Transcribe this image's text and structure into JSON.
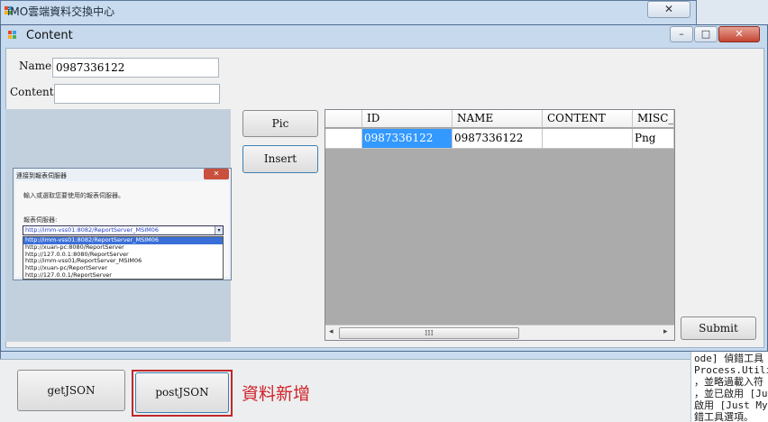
{
  "back_window": {
    "title": "iMO雲端資料交換中心",
    "close_glyph": "✕"
  },
  "content_window": {
    "title": "Content",
    "minimize_glyph": "–",
    "maximize_glyph": "□",
    "close_glyph": "✕",
    "name_label": "Name",
    "name_value": "0987336122",
    "content_label": "Content",
    "content_value": "",
    "pic_button": "Pic",
    "insert_button": "Insert",
    "submit_button": "Submit"
  },
  "embedded_dialog": {
    "title": "連接到報表伺服器",
    "close_glyph": "✕",
    "description": "輸入或選取您要使用的報表伺服器。",
    "combo_label": "報表伺服器:",
    "combo_value": "http://imm-vss01:8082/ReportServer_MSIM06",
    "combo_arrow": "▾",
    "options": [
      "http://imm-vss01:8082/ReportServer_MSIM06",
      "http://xuan-pc:8080/ReportServer",
      "http://127.0.0.1:8080/ReportServer",
      "http://imm-vss01/ReportServer_MSIM06",
      "http://xuan-pc/ReportServer",
      "http://127.0.0.1/ReportServer"
    ]
  },
  "grid": {
    "columns": [
      "ID",
      "NAME",
      "CONTENT",
      "MISC_T"
    ],
    "rows": [
      [
        "0987336122",
        "0987336122",
        "",
        "Png"
      ]
    ],
    "scroll_left": "◂",
    "scroll_right": "▸",
    "thumb_grip": "III"
  },
  "bottom": {
    "get_button": "getJSON",
    "post_button": "postJSON",
    "annotation": "資料新增"
  },
  "console_lines": [
    "ode] 偵錯工具",
    "Process.Utilit",
    "，並略過載入符",
    "，並已啟用 [Ju",
    "啟用 [Just My",
    "錯工具選項。"
  ],
  "colors": {
    "annotation_red": "#d2232a",
    "selection_blue": "#3399ff",
    "window_frame": "#c7d9ed"
  }
}
